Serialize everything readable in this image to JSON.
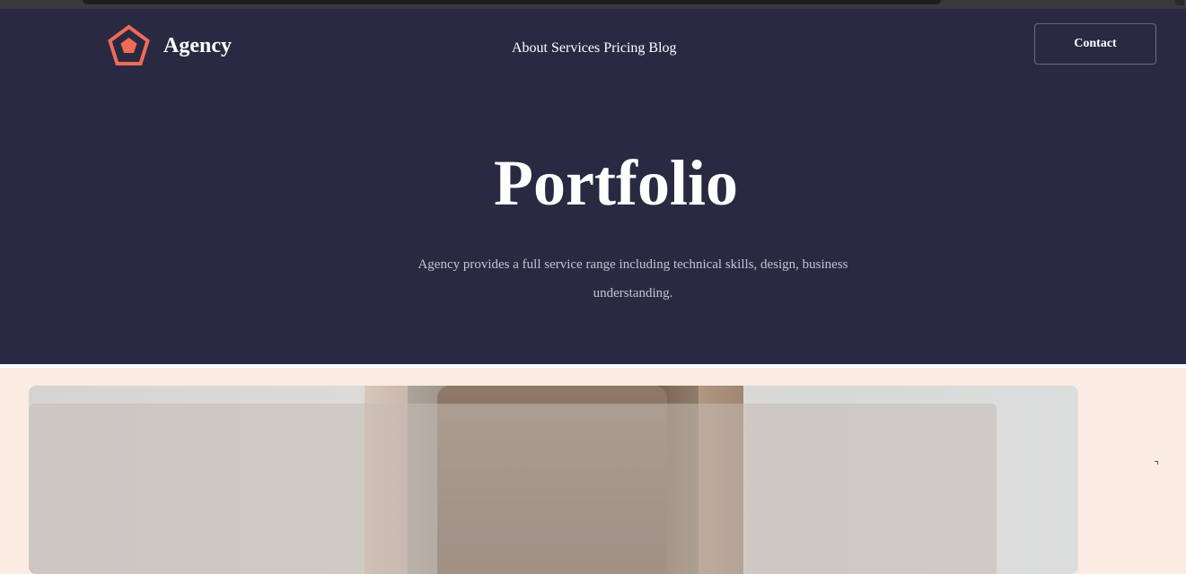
{
  "header": {
    "brand_name": "Agency",
    "nav": {
      "items": [
        {
          "label": "About"
        },
        {
          "label": "Services"
        },
        {
          "label": "Pricing"
        },
        {
          "label": "Blog"
        }
      ]
    },
    "contact_label": "Contact"
  },
  "hero": {
    "title": "Portfolio",
    "description": "Agency provides a full service range including technical skills, design, business understanding."
  },
  "colors": {
    "hero_background": "#292a41",
    "accent": "#ef6b57",
    "page_background": "#fbece3"
  },
  "icons": {
    "logo": "pentagon-logo-icon"
  }
}
